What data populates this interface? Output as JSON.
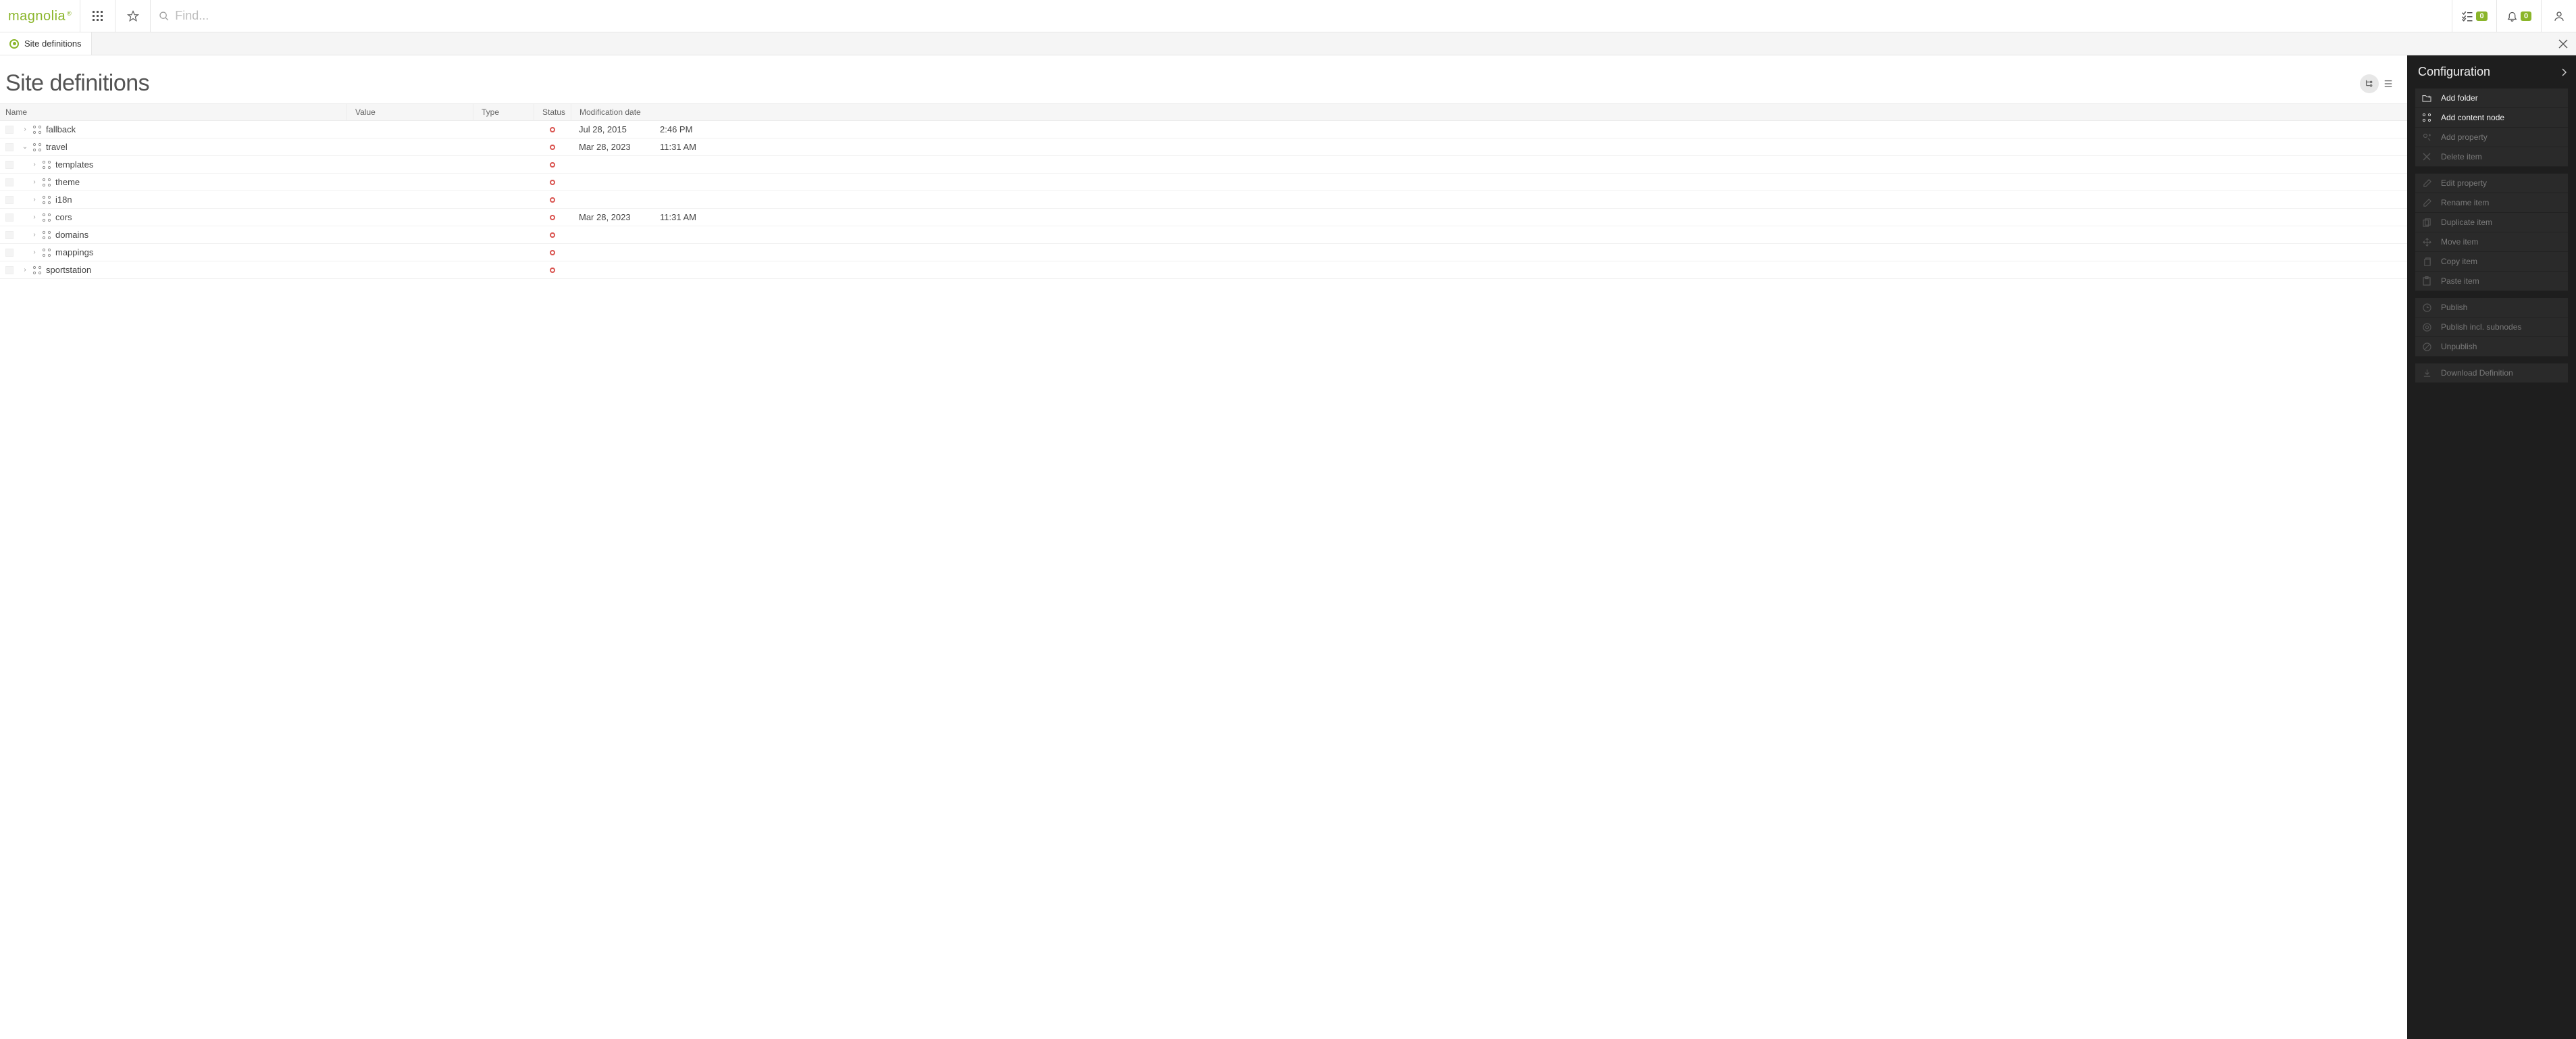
{
  "header": {
    "logo_text": "magnolia",
    "search_placeholder": "Find...",
    "tasks_badge": "0",
    "notif_badge": "0"
  },
  "tab": {
    "label": "Site definitions"
  },
  "page": {
    "title": "Site definitions"
  },
  "columns": {
    "name": "Name",
    "value": "Value",
    "type": "Type",
    "status": "Status",
    "mod": "Modification date"
  },
  "rows": [
    {
      "indent": 0,
      "expanded": false,
      "hasArrow": true,
      "name": "fallback",
      "mod_date": "Jul 28, 2015",
      "mod_time": "2:46 PM"
    },
    {
      "indent": 0,
      "expanded": true,
      "hasArrow": true,
      "name": "travel",
      "mod_date": "Mar 28, 2023",
      "mod_time": "11:31 AM"
    },
    {
      "indent": 1,
      "expanded": false,
      "hasArrow": true,
      "name": "templates",
      "mod_date": "",
      "mod_time": ""
    },
    {
      "indent": 1,
      "expanded": false,
      "hasArrow": true,
      "name": "theme",
      "mod_date": "",
      "mod_time": ""
    },
    {
      "indent": 1,
      "expanded": false,
      "hasArrow": true,
      "name": "i18n",
      "mod_date": "",
      "mod_time": ""
    },
    {
      "indent": 1,
      "expanded": false,
      "hasArrow": true,
      "name": "cors",
      "mod_date": "Mar 28, 2023",
      "mod_time": "11:31 AM"
    },
    {
      "indent": 1,
      "expanded": false,
      "hasArrow": true,
      "name": "domains",
      "mod_date": "",
      "mod_time": ""
    },
    {
      "indent": 1,
      "expanded": false,
      "hasArrow": true,
      "name": "mappings",
      "mod_date": "",
      "mod_time": ""
    },
    {
      "indent": 0,
      "expanded": false,
      "hasArrow": true,
      "name": "sportstation",
      "mod_date": "",
      "mod_time": ""
    }
  ],
  "sidepanel": {
    "title": "Configuration",
    "groups": [
      [
        {
          "icon": "folder-add-icon",
          "label": "Add folder",
          "enabled": true
        },
        {
          "icon": "node-add-icon",
          "label": "Add content node",
          "enabled": true
        },
        {
          "icon": "property-add-icon",
          "label": "Add property",
          "enabled": false
        },
        {
          "icon": "delete-icon",
          "label": "Delete item",
          "enabled": false
        }
      ],
      [
        {
          "icon": "edit-icon",
          "label": "Edit property",
          "enabled": false
        },
        {
          "icon": "rename-icon",
          "label": "Rename item",
          "enabled": false
        },
        {
          "icon": "duplicate-icon",
          "label": "Duplicate item",
          "enabled": false
        },
        {
          "icon": "move-icon",
          "label": "Move item",
          "enabled": false
        },
        {
          "icon": "copy-icon",
          "label": "Copy item",
          "enabled": false
        },
        {
          "icon": "paste-icon",
          "label": "Paste item",
          "enabled": false
        }
      ],
      [
        {
          "icon": "publish-icon",
          "label": "Publish",
          "enabled": false
        },
        {
          "icon": "publish-sub-icon",
          "label": "Publish incl. subnodes",
          "enabled": false
        },
        {
          "icon": "unpublish-icon",
          "label": "Unpublish",
          "enabled": false
        }
      ],
      [
        {
          "icon": "download-icon",
          "label": "Download Definition",
          "enabled": false
        }
      ]
    ]
  }
}
